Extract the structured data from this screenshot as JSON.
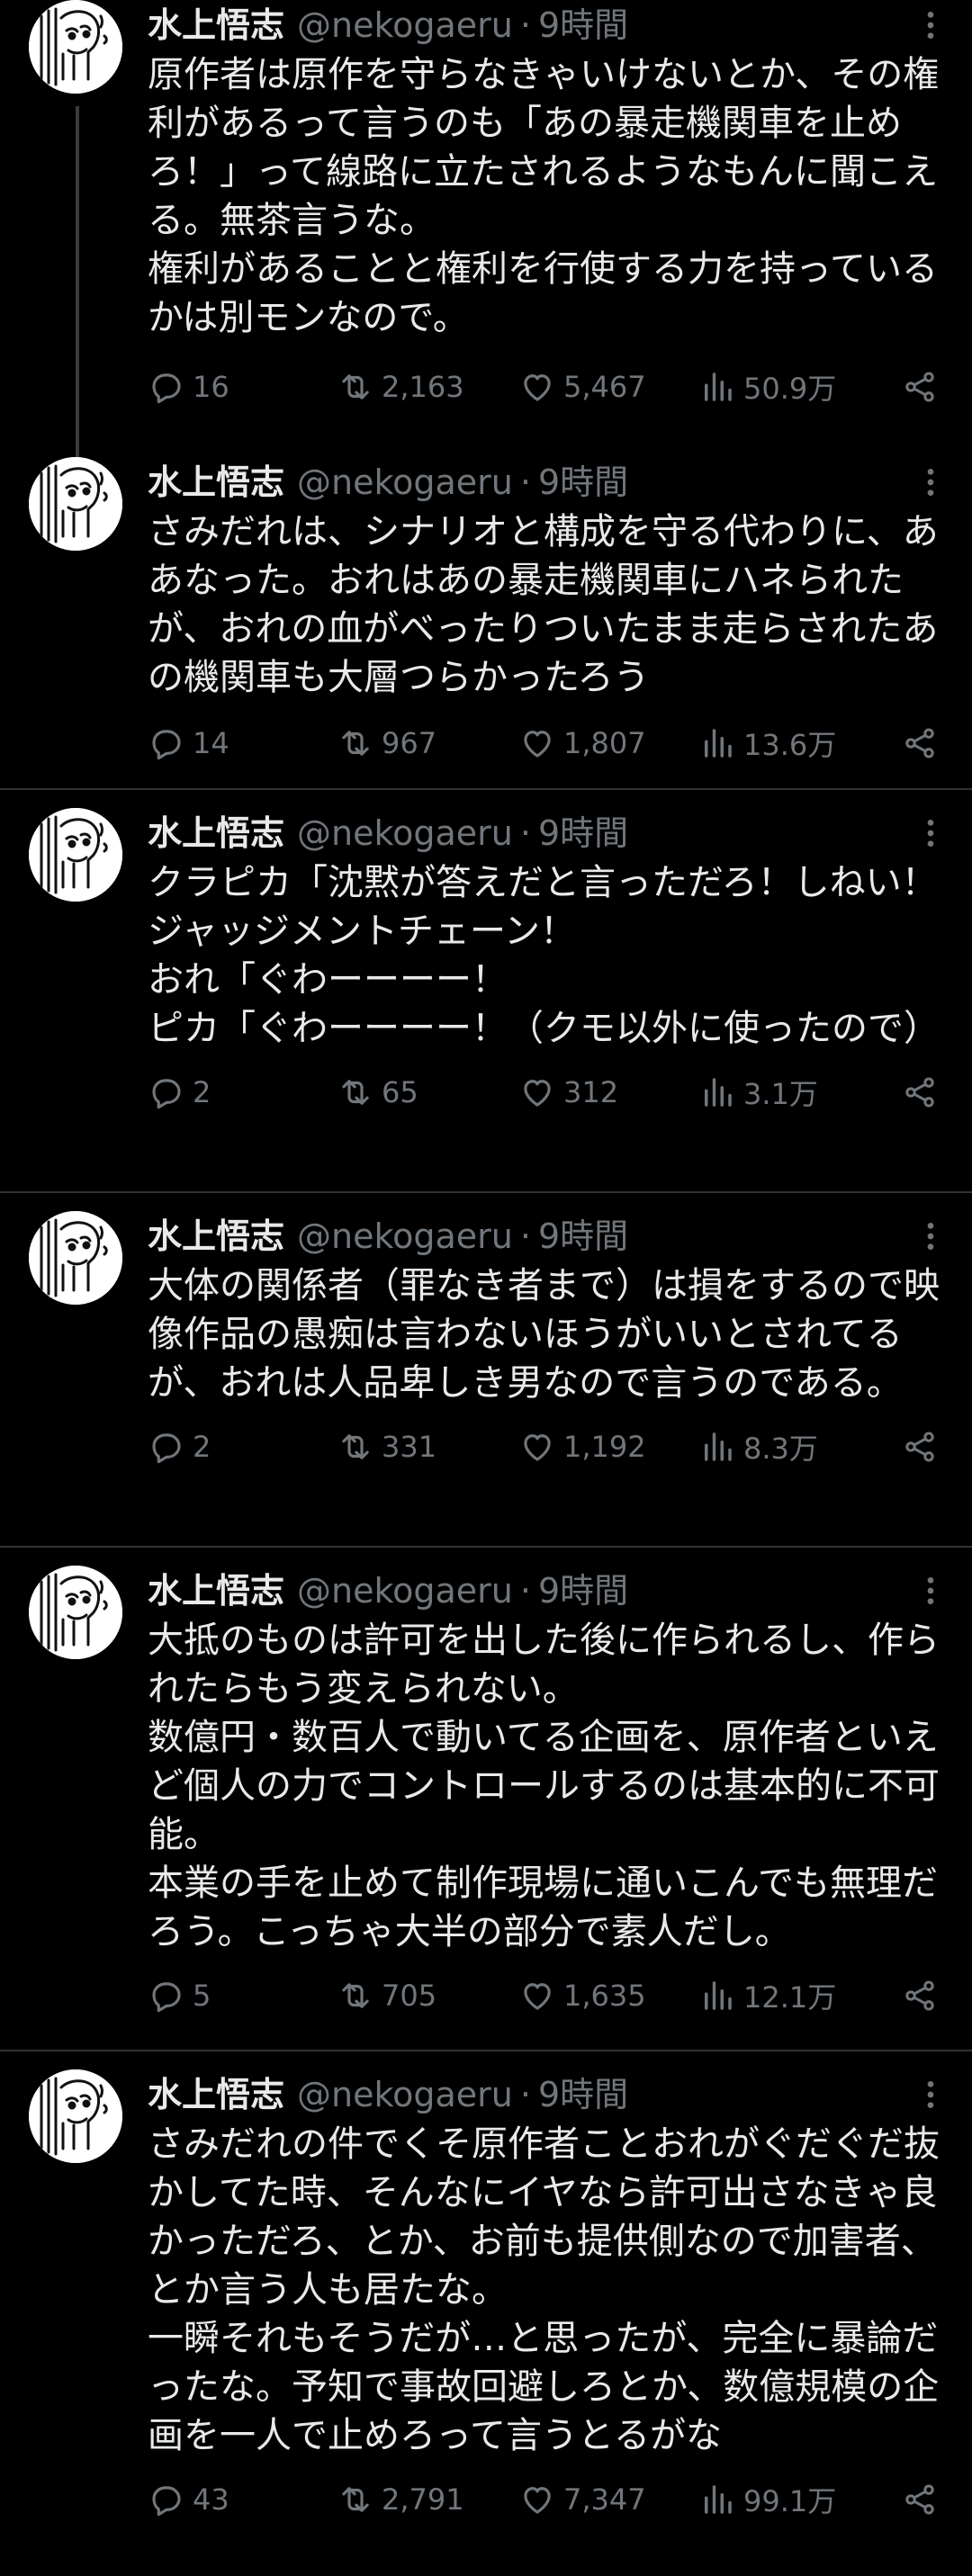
{
  "user": {
    "name": "水上悟志",
    "handle": "@nekogaeru",
    "separator": "·"
  },
  "icons": {
    "reply": "reply-icon",
    "retweet": "retweet-icon",
    "like": "heart-icon",
    "views": "views-icon",
    "share": "share-icon",
    "more": "more-icon"
  },
  "colors": {
    "background": "#000000",
    "text": "#e7e9ea",
    "muted": "#71767b",
    "divider": "#2f3336"
  },
  "tweets": [
    {
      "time": "9時間",
      "text": "原作者は原作を守らなきゃいけないとか、その権利があるって言うのも「あの暴走機関車を止めろ！」って線路に立たされるようなもんに聞こえる。無茶言うな。\n権利があることと権利を行使する力を持っているかは別モンなので。",
      "replies": "16",
      "retweets": "2,163",
      "likes": "5,467",
      "views": "50.9万"
    },
    {
      "time": "9時間",
      "text": "さみだれは、シナリオと構成を守る代わりに、ああなった。おれはあの暴走機関車にハネられたが、おれの血がべったりついたまま走らされたあの機関車も大層つらかったろう",
      "replies": "14",
      "retweets": "967",
      "likes": "1,807",
      "views": "13.6万"
    },
    {
      "time": "9時間",
      "text": "クラピカ「沈黙が答えだと言っただろ！しねい！ジャッジメントチェーン！\nおれ「ぐわーーーー！\nピカ「ぐわーーーー！（クモ以外に使ったので）",
      "replies": "2",
      "retweets": "65",
      "likes": "312",
      "views": "3.1万"
    },
    {
      "time": "9時間",
      "text": "大体の関係者（罪なき者まで）は損をするので映像作品の愚痴は言わないほうがいいとされてるが、おれは人品卑しき男なので言うのである。",
      "replies": "2",
      "retweets": "331",
      "likes": "1,192",
      "views": "8.3万"
    },
    {
      "time": "9時間",
      "text": "大抵のものは許可を出した後に作られるし、作られたらもう変えられない。\n数億円・数百人で動いてる企画を、原作者といえど個人の力でコントロールするのは基本的に不可能。\n本業の手を止めて制作現場に通いこんでも無理だろう。こっちゃ大半の部分で素人だし。",
      "replies": "5",
      "retweets": "705",
      "likes": "1,635",
      "views": "12.1万"
    },
    {
      "time": "9時間",
      "text": "さみだれの件でくそ原作者ことおれがぐだぐだ抜かしてた時、そんなにイヤなら許可出さなきゃ良かっただろ、とか、お前も提供側なので加害者、とか言う人も居たな。\n一瞬それもそうだが…と思ったが、完全に暴論だったな。予知で事故回避しろとか、数億規模の企画を一人で止めろって言うとるがな",
      "replies": "43",
      "retweets": "2,791",
      "likes": "7,347",
      "views": "99.1万"
    }
  ]
}
